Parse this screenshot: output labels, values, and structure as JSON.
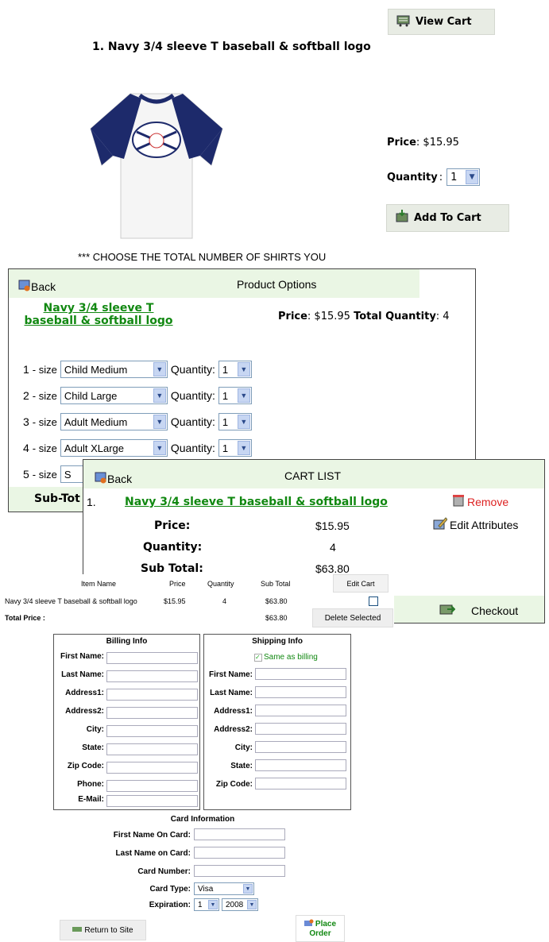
{
  "top": {
    "view_cart_label": "View Cart",
    "product_title": "1. Navy 3/4 sleeve T baseball & softball logo",
    "price_label": "Price",
    "price_value": ": $15.95",
    "quantity_label": "Quantity",
    "quantity_value": "1",
    "add_to_cart_label": "Add To Cart",
    "choose_note": "*** CHOOSE THE TOTAL NUMBER OF SHIRTS YOU"
  },
  "options_panel": {
    "back_label": "Back",
    "title": "Product Options",
    "product_link_line1": "Navy 3/4 sleeve T",
    "product_link_line2": "baseball & softball logo",
    "price_label": "Price",
    "price_value": ": $15.95",
    "total_qty_label": "Total Quantity",
    "total_qty_value": ": 4",
    "size_suffix": "- size",
    "qty_label": "Quantity:",
    "rows": [
      {
        "num": "1",
        "size": "Child Medium",
        "qty": "1"
      },
      {
        "num": "2",
        "size": "Child Large",
        "qty": "1"
      },
      {
        "num": "3",
        "size": "Adult Medium",
        "qty": "1"
      },
      {
        "num": "4",
        "size": "Adult XLarge",
        "qty": "1"
      },
      {
        "num": "5",
        "size": "S",
        "qty": ""
      }
    ],
    "subtotal_label": "Sub-Tot"
  },
  "cart_panel": {
    "back_label": "Back",
    "title": "CART LIST",
    "item_num": "1.",
    "product_link": "Navy 3/4 sleeve T baseball & softball logo",
    "remove_label": "Remove",
    "edit_label": "Edit Attributes",
    "price_label": "Price:",
    "price_value": "$15.95",
    "qty_label": "Quantity:",
    "qty_value": "4",
    "subtotal_label": "Sub Total:",
    "subtotal_value": "$63.80",
    "checkout_label": "Checkout"
  },
  "cart_table": {
    "headers": [
      "Item Name",
      "Price",
      "Quantity",
      "Sub Total"
    ],
    "edit_cart_label": "Edit Cart",
    "row": {
      "name": "Navy 3/4 sleeve T baseball & softball logo",
      "price": "$15.95",
      "qty": "4",
      "subtotal": "$63.80"
    },
    "total_label": "Total Price :",
    "total_value": "$63.80",
    "delete_label": "Delete Selected"
  },
  "billing": {
    "title": "Billing Info",
    "fields": [
      "First Name:",
      "Last Name:",
      "Address1:",
      "Address2:",
      "City:",
      "State:",
      "Zip Code:",
      "Phone:",
      "E-Mail:"
    ]
  },
  "shipping": {
    "title": "Shipping Info",
    "same_label": "Same as billing",
    "fields": [
      "First Name:",
      "Last Name:",
      "Address1:",
      "Address2:",
      "City:",
      "State:",
      "Zip Code:"
    ]
  },
  "card": {
    "title": "Card Information",
    "first_label": "First Name On Card:",
    "last_label": "Last Name on Card:",
    "number_label": "Card Number:",
    "type_label": "Card Type:",
    "type_value": "Visa",
    "exp_label": "Expiration:",
    "exp_month": "1",
    "exp_year": "2008"
  },
  "footer": {
    "return_label": "Return to Site",
    "place_label_1": "Place",
    "place_label_2": "Order"
  },
  "colors": {
    "link_green": "#118811",
    "header_green": "#eaf6e4",
    "remove_red": "#dd2222"
  }
}
